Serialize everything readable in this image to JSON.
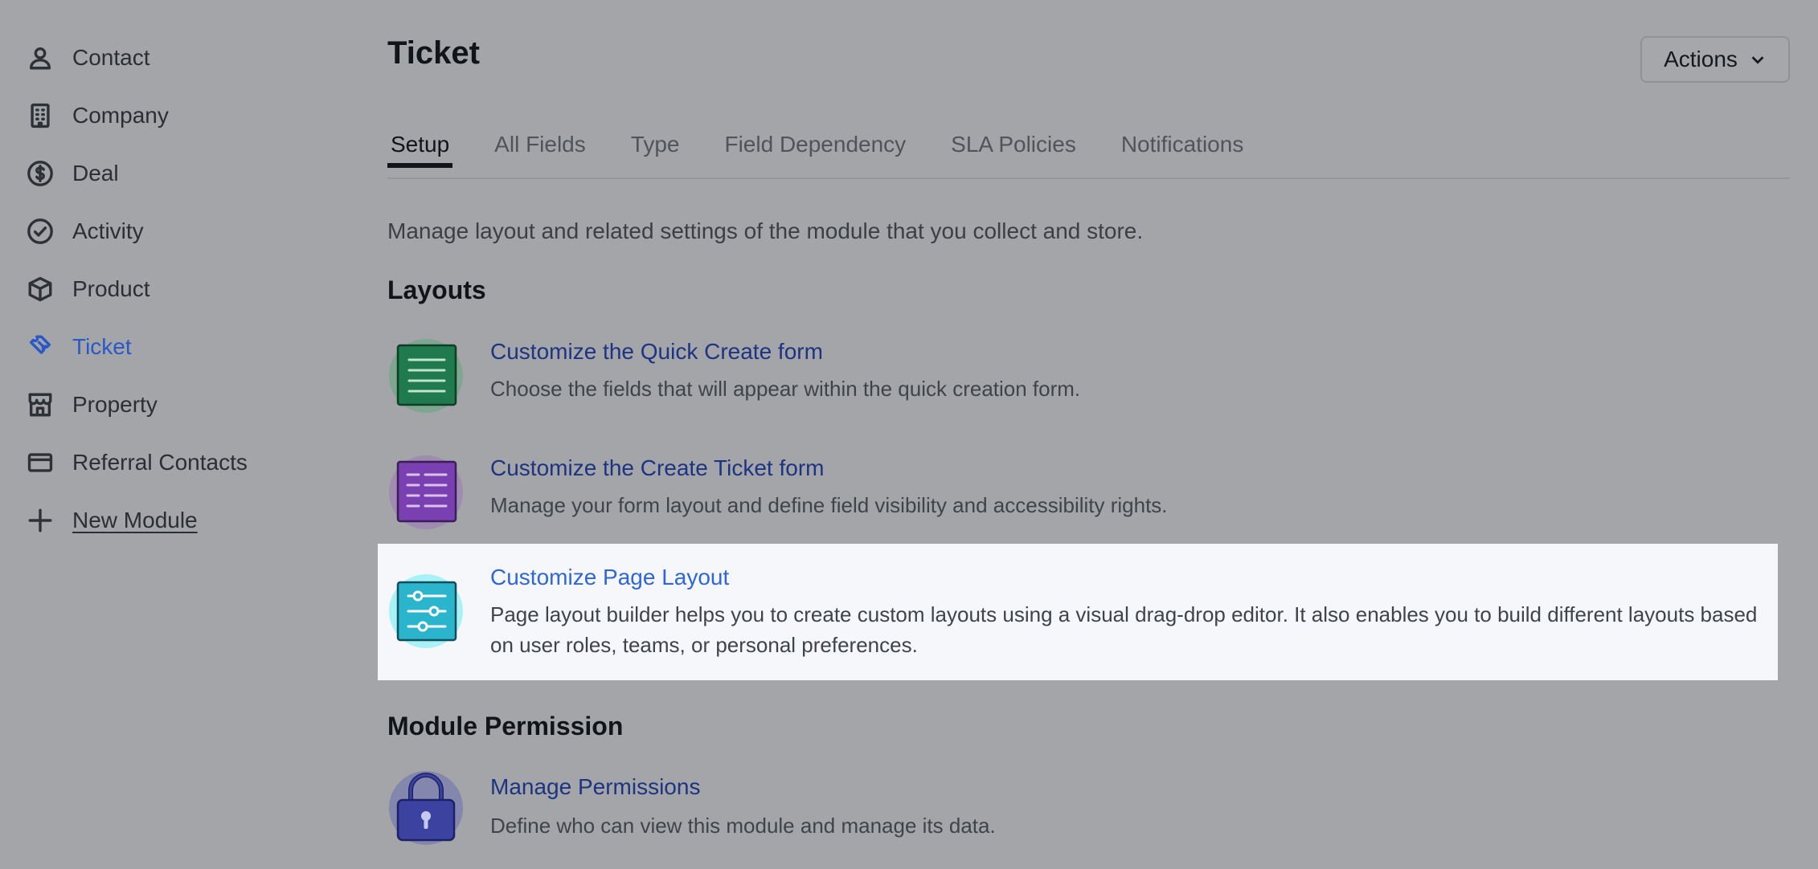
{
  "sidebar": {
    "items": [
      {
        "label": "Contact",
        "icon": "person-icon"
      },
      {
        "label": "Company",
        "icon": "building-icon"
      },
      {
        "label": "Deal",
        "icon": "dollar-circle-icon"
      },
      {
        "label": "Activity",
        "icon": "check-circle-icon"
      },
      {
        "label": "Product",
        "icon": "box-icon"
      },
      {
        "label": "Ticket",
        "icon": "ticket-icon",
        "active": true
      },
      {
        "label": "Property",
        "icon": "storefront-icon"
      },
      {
        "label": "Referral Contacts",
        "icon": "card-icon"
      },
      {
        "label": "New Module",
        "icon": "plus-icon"
      }
    ]
  },
  "header": {
    "title": "Ticket",
    "actions_label": "Actions"
  },
  "tabs": [
    "Setup",
    "All Fields",
    "Type",
    "Field Dependency",
    "SLA Policies",
    "Notifications"
  ],
  "intro": "Manage layout and related settings of the module that you collect and store.",
  "layouts": {
    "heading": "Layouts",
    "items": [
      {
        "title": "Customize the Quick Create form",
        "desc": "Choose the fields that will appear within the quick creation form.",
        "icon": "form-lines-icon",
        "color": "#1f7a4d"
      },
      {
        "title": "Customize the Create Ticket form",
        "desc": "Manage your form layout and define field visibility and accessibility rights.",
        "icon": "form-grid-icon",
        "color": "#7a3fb0"
      },
      {
        "title": "Customize Page Layout",
        "desc": "Page layout builder helps you to create custom layouts using a visual drag-drop editor. It also enables you to build different layouts based on user roles, teams, or personal preferences.",
        "icon": "sliders-icon",
        "color": "#2bb5cc"
      }
    ]
  },
  "permission": {
    "heading": "Module Permission",
    "items": [
      {
        "title": "Manage Permissions",
        "desc": "Define who can view this module and manage its data.",
        "icon": "padlock-icon",
        "color": "#3b42a0"
      }
    ]
  }
}
